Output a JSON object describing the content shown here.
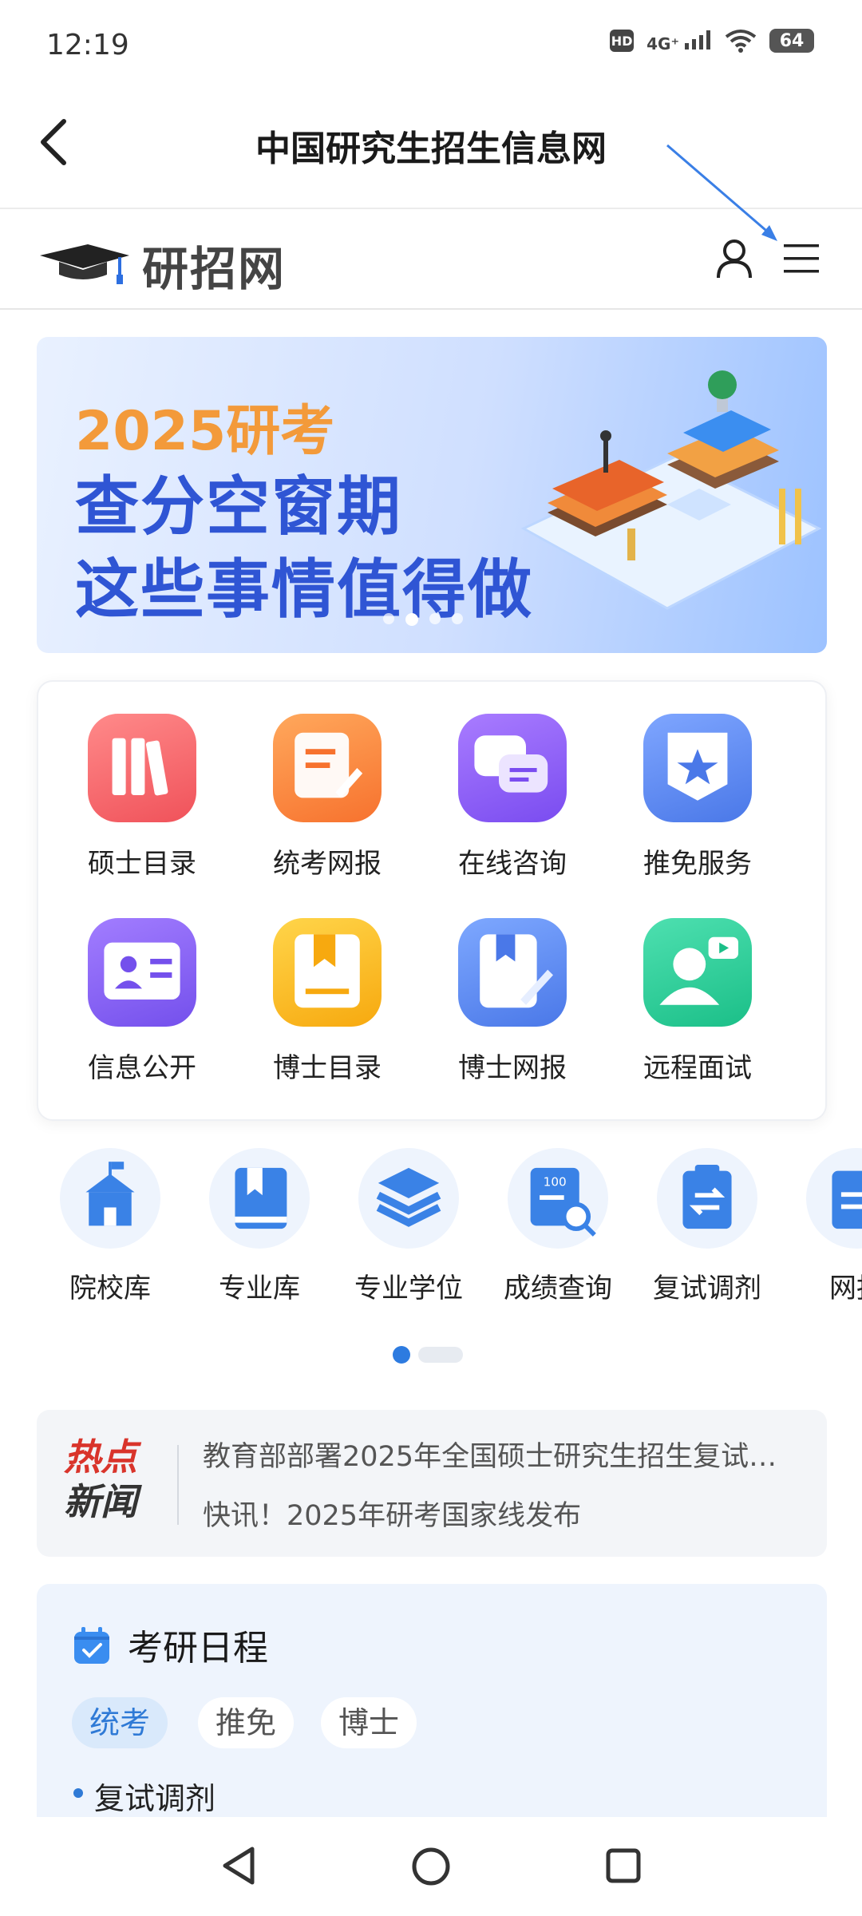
{
  "status_bar": {
    "time": "12:19",
    "hd": "HD",
    "network": "4G⁺",
    "battery": "64"
  },
  "title_bar": {
    "title": "中国研究生招生信息网"
  },
  "site_header": {
    "logo_text": "研招网"
  },
  "banner": {
    "year_text": "2025研考",
    "line1": "查分空窗期",
    "line2": "这些事情值得做",
    "page_count": 4,
    "active_page": 2
  },
  "services": [
    {
      "label": "硕士目录",
      "icon": "books-icon",
      "color_from": "#ff8a8a",
      "color_to": "#f0525a"
    },
    {
      "label": "统考网报",
      "icon": "edit-doc-icon",
      "color_from": "#ffa85c",
      "color_to": "#f7722e"
    },
    {
      "label": "在线咨询",
      "icon": "chat-icon",
      "color_from": "#a97cff",
      "color_to": "#7a4cf0"
    },
    {
      "label": "推免服务",
      "icon": "star-badge-icon",
      "color_from": "#7fa6ff",
      "color_to": "#4a78e8"
    },
    {
      "label": "信息公开",
      "icon": "id-card-icon",
      "color_from": "#a27dff",
      "color_to": "#7450ec"
    },
    {
      "label": "博士目录",
      "icon": "bookmark-book-icon",
      "color_from": "#ffd54a",
      "color_to": "#f7a90f"
    },
    {
      "label": "博士网报",
      "icon": "book-pen-icon",
      "color_from": "#7ea8ff",
      "color_to": "#4a78e8"
    },
    {
      "label": "远程面试",
      "icon": "video-user-icon",
      "color_from": "#4ee0b0",
      "color_to": "#1bbf88"
    }
  ],
  "quick_links": [
    {
      "label": "院校库",
      "icon": "school-icon"
    },
    {
      "label": "专业库",
      "icon": "book-icon"
    },
    {
      "label": "专业学位",
      "icon": "layers-icon"
    },
    {
      "label": "成绩查询",
      "icon": "score-search-icon"
    },
    {
      "label": "复试调剂",
      "icon": "transfer-icon"
    },
    {
      "label": "网报",
      "icon": "clipboard-icon"
    }
  ],
  "hot_news": {
    "logo_line1": "热点",
    "logo_line2": "新闻",
    "items": [
      "教育部部署2025年全国硕士研究生招生复试…",
      "快讯！2025年研考国家线发布"
    ]
  },
  "schedule": {
    "title": "考研日程",
    "tabs": [
      "统考",
      "推免",
      "博士"
    ],
    "active_tab": 0,
    "items": [
      "复试调剂"
    ]
  },
  "colors": {
    "accent": "#2f7ad6",
    "banner_title": "#2f55d4",
    "banner_year": "#f39a3a",
    "hot_red": "#d9342b"
  }
}
